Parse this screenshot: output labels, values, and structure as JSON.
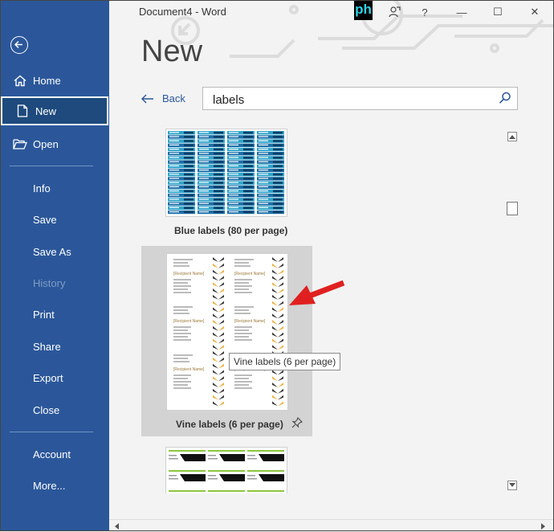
{
  "window": {
    "title": "Document4  -  Word",
    "logo_text": "ph",
    "help_label": "?",
    "minimize_label": "—",
    "maximize_label": "☐",
    "close_label": "✕"
  },
  "sidebar": {
    "items": [
      {
        "label": "Home",
        "icon": "home-icon"
      },
      {
        "label": "New",
        "icon": "new-document-icon",
        "selected": true
      },
      {
        "label": "Open",
        "icon": "folder-open-icon"
      },
      {
        "label": "Info"
      },
      {
        "label": "Save"
      },
      {
        "label": "Save As"
      },
      {
        "label": "History",
        "disabled": true
      },
      {
        "label": "Print"
      },
      {
        "label": "Share"
      },
      {
        "label": "Export"
      },
      {
        "label": "Close"
      },
      {
        "label": "Account"
      },
      {
        "label": "More..."
      }
    ]
  },
  "main": {
    "heading": "New",
    "back_label": "Back",
    "search_value": "labels",
    "templates": [
      {
        "label": "Blue labels (80 per page)"
      },
      {
        "label": "Vine labels (6 per page)",
        "selected": true
      },
      {
        "label": ""
      }
    ],
    "tooltip": "Vine labels (6 per page)",
    "recipient_name": "[Recipient Name]"
  },
  "colors": {
    "sidebar": "#2b579a",
    "accent": "#2b579a",
    "arrow": "#e02020",
    "logo_text": "#2ed3e6"
  }
}
